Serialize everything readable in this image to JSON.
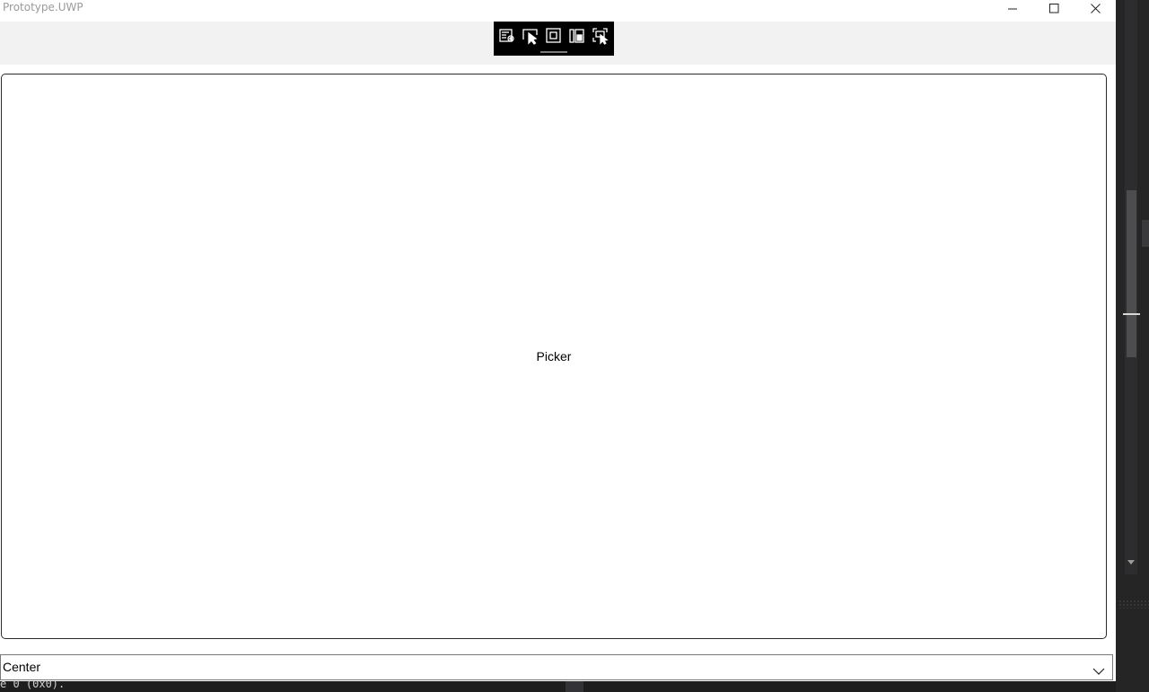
{
  "window": {
    "title": "Prototype.UWP",
    "controls": {
      "minimize_icon": "minimize-icon",
      "maximize_icon": "maximize-icon",
      "close_icon": "close-icon"
    }
  },
  "devtools": {
    "buttons": [
      "live-visual-tree-icon",
      "select-element-icon",
      "display-layout-adorners-icon",
      "track-focus-icon",
      "preview-selection-icon"
    ]
  },
  "content": {
    "picker_label": "Picker"
  },
  "combobox": {
    "selected": "Center"
  },
  "background": {
    "console_text": "e 0 (0x0)."
  },
  "colors": {
    "title_text": "#9a9a9a",
    "toolbar_strip": "#f2f2f2",
    "devtools_bg": "#000000",
    "ide_bg": "#1e1e1e"
  }
}
